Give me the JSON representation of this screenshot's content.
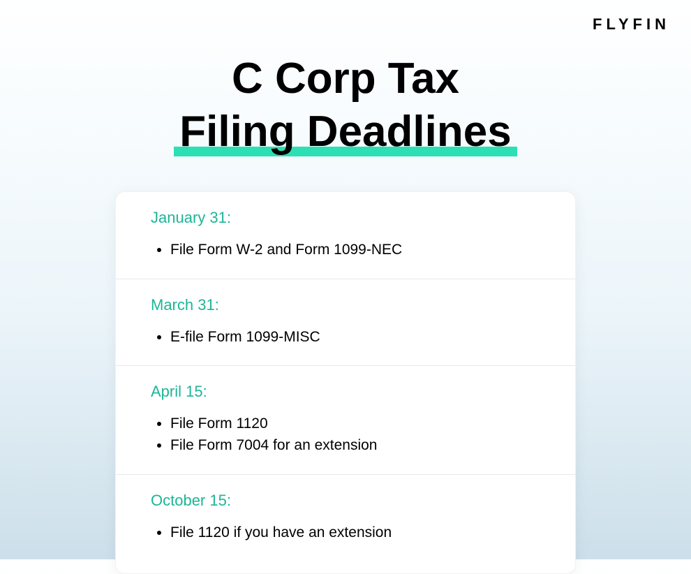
{
  "brand": "FLYFIN",
  "title": {
    "line1": "C Corp Tax",
    "line2": "Filing Deadlines"
  },
  "sections": [
    {
      "date": "January 31:",
      "items": [
        "File Form W-2 and Form 1099-NEC"
      ]
    },
    {
      "date": "March 31:",
      "items": [
        "E-file Form 1099-MISC"
      ]
    },
    {
      "date": "April 15:",
      "items": [
        "File Form 1120",
        "File Form 7004 for an extension"
      ]
    },
    {
      "date": "October 15:",
      "items": [
        "File 1120 if you have an extension"
      ]
    }
  ]
}
